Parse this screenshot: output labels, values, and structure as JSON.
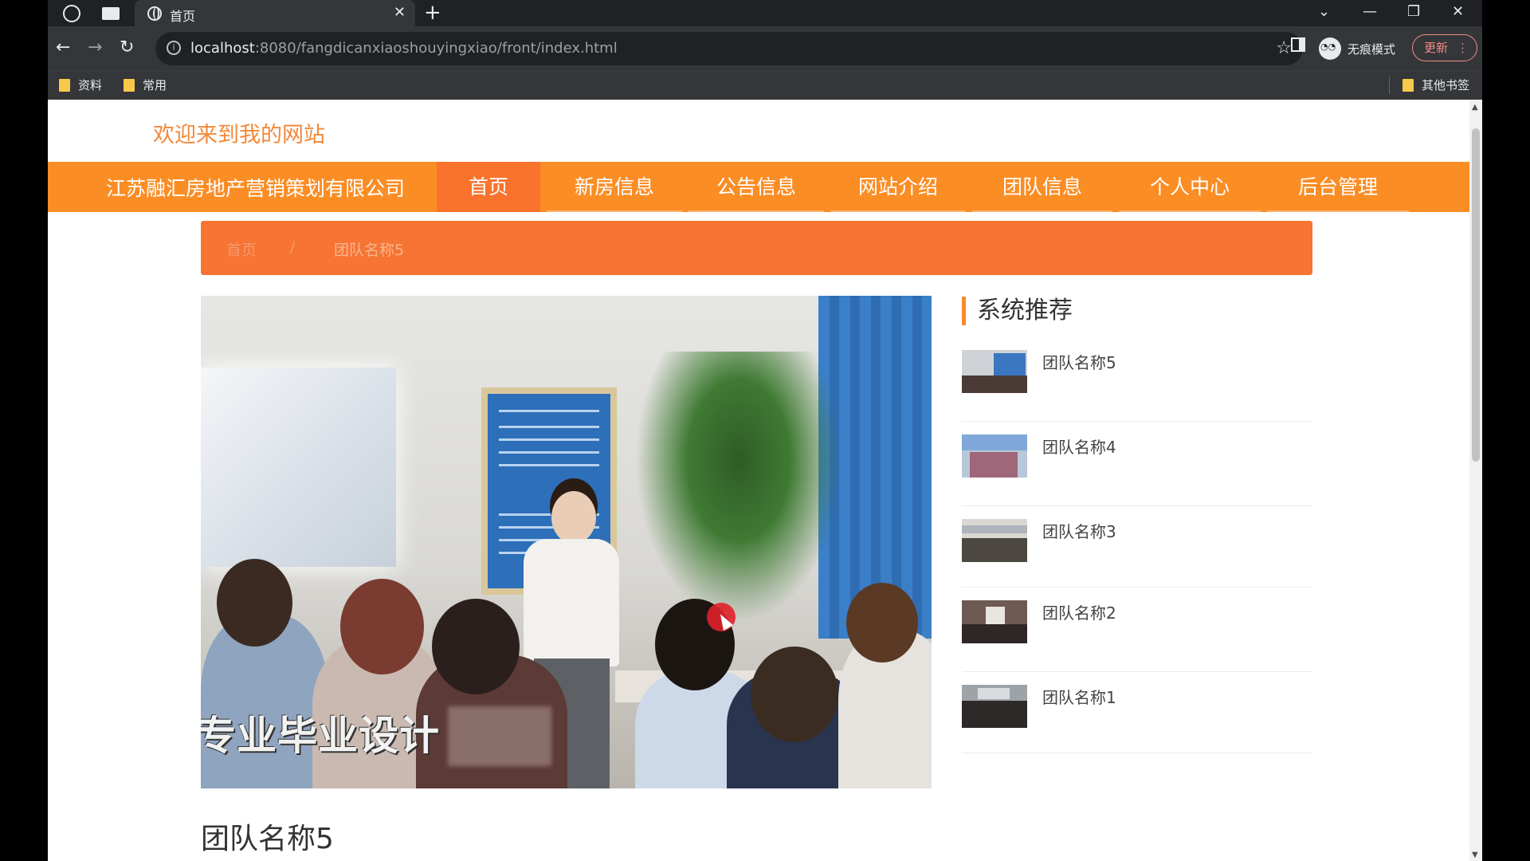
{
  "browser": {
    "tab_title": "首页",
    "url_host": "localhost",
    "url_rest": ":8080/fangdicanxiaoshouyingxiao/front/index.html",
    "incognito_label": "无痕模式",
    "update_label": "更新",
    "bookmarks": [
      "资料",
      "常用"
    ],
    "other_bookmarks": "其他书签"
  },
  "site": {
    "welcome": "欢迎来到我的网站",
    "brand": "江苏融汇房地产营销策划有限公司",
    "nav": [
      "首页",
      "新房信息",
      "公告信息",
      "网站介绍",
      "团队信息",
      "个人中心",
      "后台管理"
    ],
    "active_nav": "首页",
    "accent_color": "#fb8d25"
  },
  "breadcrumb": {
    "home": "首页",
    "separator": "/",
    "current": "团队名称5"
  },
  "hero": {
    "caption": "专业毕业设计"
  },
  "sidebar": {
    "title": "系统推荐",
    "items": [
      {
        "name": "团队名称5"
      },
      {
        "name": "团队名称4"
      },
      {
        "name": "团队名称3"
      },
      {
        "name": "团队名称2"
      },
      {
        "name": "团队名称1"
      }
    ]
  },
  "detail": {
    "title": "团队名称5"
  }
}
